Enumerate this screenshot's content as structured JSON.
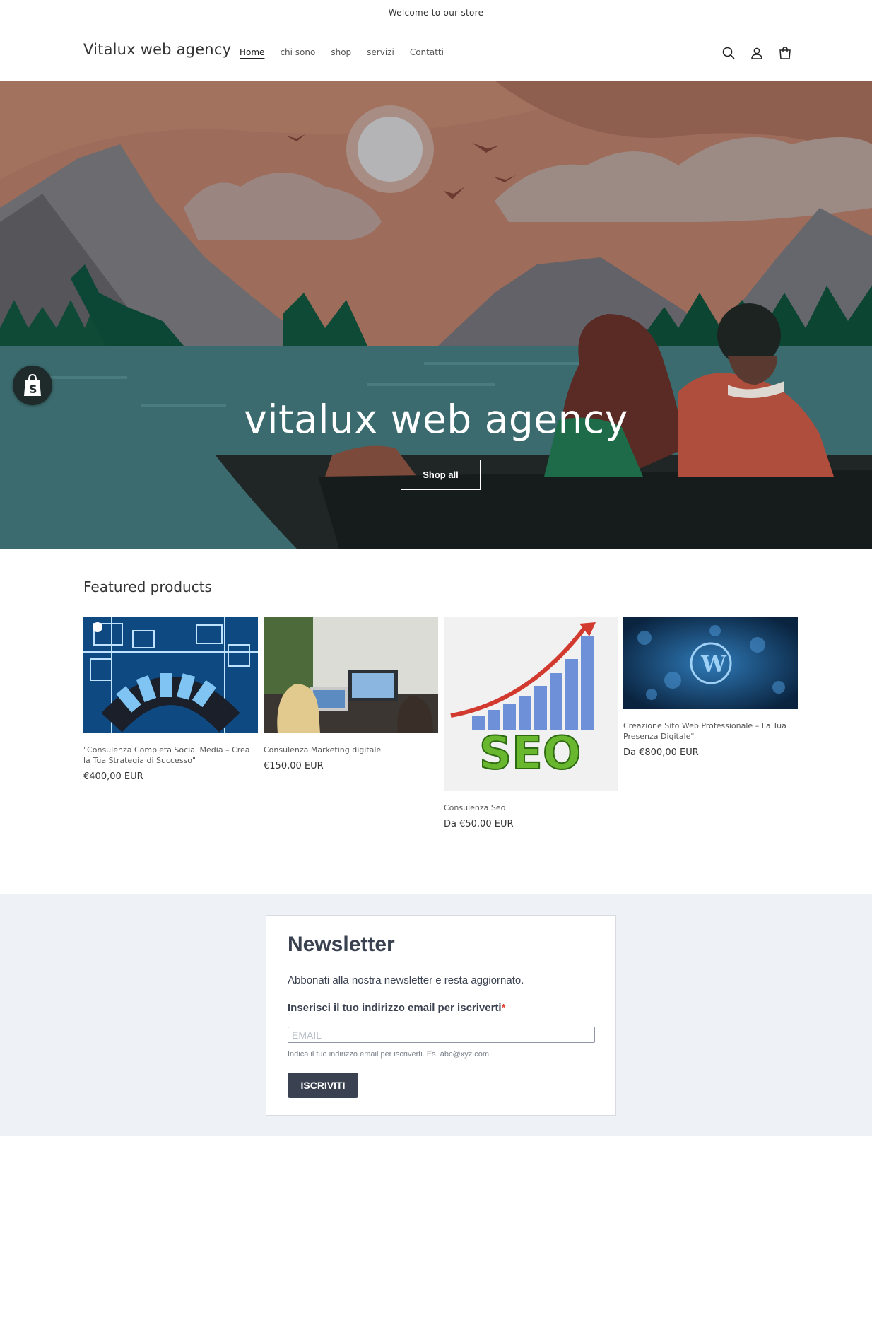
{
  "announcement": "Welcome to our store",
  "header": {
    "logo": "Vitalux web agency",
    "nav": [
      "Home",
      "chi sono",
      "shop",
      "servizi",
      "Contatti"
    ],
    "icons": [
      "search-icon",
      "account-icon",
      "cart-icon"
    ]
  },
  "hero": {
    "title": "vitalux web agency",
    "button": "Shop all"
  },
  "featured": {
    "heading": "Featured products",
    "products": [
      {
        "title": "\"Consulenza Completa Social Media – Crea la Tua Strategia di Successo\"",
        "price": "€400,00 EUR"
      },
      {
        "title": "Consulenza Marketing digitale",
        "price": "€150,00 EUR"
      },
      {
        "title": "Consulenza Seo",
        "price": "Da €50,00 EUR"
      },
      {
        "title": "Creazione Sito Web Professionale – La Tua Presenza Digitale\"",
        "price": "Da €800,00 EUR"
      }
    ]
  },
  "newsletter": {
    "title": "Newsletter",
    "subtitle": "Abbonati alla nostra newsletter e resta aggiornato.",
    "label": "Inserisci il tuo indirizzo email per iscriverti",
    "required_mark": "*",
    "placeholder": "EMAIL",
    "hint": "Indica il tuo indirizzo email per iscriverti. Es. abc@xyz.com",
    "button": "ISCRIVITI"
  },
  "colors": {
    "sky": "#a06e5c",
    "lake": "#3b6b6e",
    "newsletter_button": "#3a4150",
    "newsletter_band": "#eef1f5"
  }
}
